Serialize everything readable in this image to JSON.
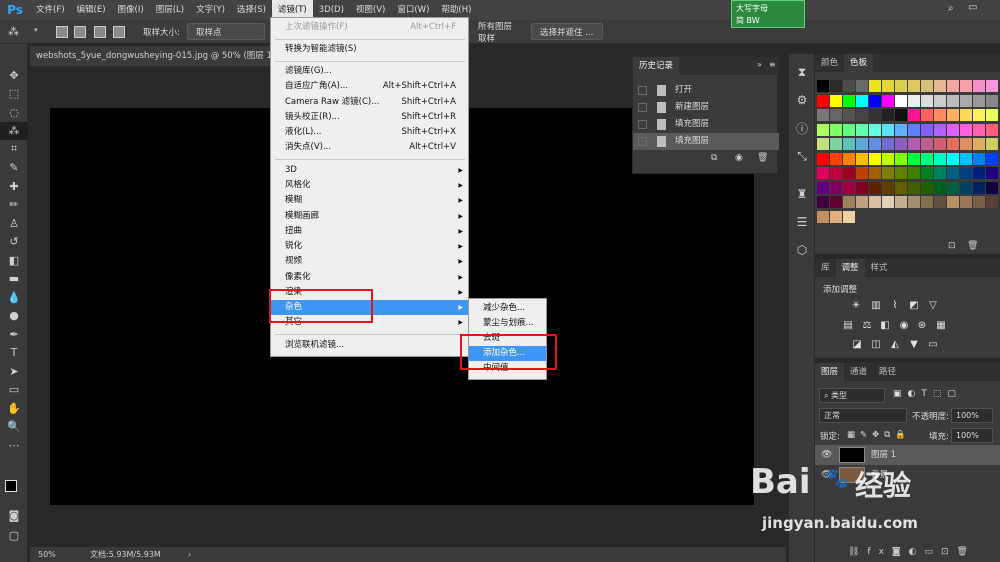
{
  "app": {
    "logo": "Ps"
  },
  "menubar": {
    "items": [
      "文件(F)",
      "编辑(E)",
      "图像(I)",
      "图层(L)",
      "文字(Y)",
      "选择(S)",
      "滤镜(T)",
      "3D(D)",
      "视图(V)",
      "窗口(W)",
      "帮助(H)"
    ],
    "active": "滤镜(T)"
  },
  "capslock": {
    "line1": "大写字母",
    "line2": "简 BW"
  },
  "options": {
    "sample_size_label": "取样大小:",
    "sample_size_value": "取样点",
    "layer_sample_label": "所有图层取样",
    "select_mask_button": "选择并遮住 ..."
  },
  "document": {
    "tab_title": "webshots_5yue_dongwusheying-015.jpg @ 50% (图层 1, R",
    "zoom": "50%",
    "doc_info": "文档:5.93M/5.93M"
  },
  "filter_menu": {
    "items": [
      {
        "label": "上次滤镜操作(F)",
        "shortcut": "Alt+Ctrl+F",
        "disabled": true
      },
      {
        "label": "转换为智能滤镜(S)"
      },
      {
        "label": "滤镜库(G)..."
      },
      {
        "label": "自适应广角(A)...",
        "shortcut": "Alt+Shift+Ctrl+A"
      },
      {
        "label": "Camera Raw 滤镜(C)...",
        "shortcut": "Shift+Ctrl+A"
      },
      {
        "label": "镜头校正(R)...",
        "shortcut": "Shift+Ctrl+R"
      },
      {
        "label": "液化(L)...",
        "shortcut": "Shift+Ctrl+X"
      },
      {
        "label": "消失点(V)...",
        "shortcut": "Alt+Ctrl+V"
      },
      {
        "label": "3D",
        "submenu": true
      },
      {
        "label": "风格化",
        "submenu": true
      },
      {
        "label": "模糊",
        "submenu": true
      },
      {
        "label": "模糊画廊",
        "submenu": true
      },
      {
        "label": "扭曲",
        "submenu": true
      },
      {
        "label": "锐化",
        "submenu": true
      },
      {
        "label": "视频",
        "submenu": true
      },
      {
        "label": "像素化",
        "submenu": true
      },
      {
        "label": "渲染",
        "submenu": true
      },
      {
        "label": "杂色",
        "submenu": true,
        "highlighted": true
      },
      {
        "label": "其它",
        "submenu": true
      },
      {
        "label": "浏览联机滤镜..."
      }
    ]
  },
  "noise_submenu": {
    "items": [
      "减少杂色...",
      "蒙尘与划痕...",
      "去斑",
      "添加杂色...",
      "中间值..."
    ],
    "highlighted": "添加杂色..."
  },
  "history": {
    "title": "历史记录",
    "items": [
      "打开",
      "新建图层",
      "填充图层",
      "填充图层"
    ]
  },
  "swatches": {
    "tabs": [
      "颜色",
      "色板"
    ],
    "active": "色板",
    "colors": [
      [
        "#000000",
        "#2a2a2a",
        "#4c4c4c",
        "#686868",
        "#e8e420",
        "#e0d838",
        "#d8d050",
        "#e0c860",
        "#d8c078",
        "#e4b890",
        "#f0a8a0",
        "#f8a0b0",
        "#f890c8",
        "#f898d8"
      ],
      [
        "#ff0000",
        "#ffff00",
        "#00ff00",
        "#00ffff",
        "#0000ff",
        "#ff00ff",
        "#ffffff",
        "#eeeeee",
        "#dddddd",
        "#cccccc",
        "#bbbbbb",
        "#aaaaaa",
        "#999999",
        "#888888"
      ],
      [
        "#777777",
        "#666666",
        "#555555",
        "#444444",
        "#333333",
        "#222222",
        "#111111",
        "#ff1493",
        "#ff6060",
        "#ff8c60",
        "#ffb060",
        "#ffd860",
        "#fff060",
        "#e8ff60"
      ],
      [
        "#b0ff60",
        "#80ff60",
        "#60ff80",
        "#60ffb0",
        "#60ffe0",
        "#60e0ff",
        "#60b0ff",
        "#6080ff",
        "#8060ff",
        "#b060ff",
        "#e060ff",
        "#ff60e0",
        "#ff60b0",
        "#ff6080"
      ],
      [
        "#c0e080",
        "#80d0a0",
        "#60c0c0",
        "#60a8d8",
        "#6090e0",
        "#7070d0",
        "#9060c0",
        "#b060b0",
        "#c06090",
        "#d06070",
        "#e07060",
        "#e09060",
        "#e0b060",
        "#d0d060"
      ],
      [
        "#ff0000",
        "#ff4000",
        "#ff8000",
        "#ffc000",
        "#ffff00",
        "#c0ff00",
        "#80ff00",
        "#00ff40",
        "#00ff80",
        "#00ffc0",
        "#00ffff",
        "#00c0ff",
        "#0080ff",
        "#0040ff"
      ],
      [
        "#e00060",
        "#c00040",
        "#a00020",
        "#c04000",
        "#a06000",
        "#808000",
        "#608000",
        "#408000",
        "#008020",
        "#008060",
        "#006080",
        "#004080",
        "#002080",
        "#200080"
      ],
      [
        "#600080",
        "#800060",
        "#a00040",
        "#800020",
        "#602000",
        "#604000",
        "#606000",
        "#406000",
        "#206000",
        "#006020",
        "#006040",
        "#004060",
        "#002060",
        "#100040"
      ],
      [
        "#400040",
        "#600030",
        "#a08060",
        "#c0a080",
        "#d8c0a0",
        "#e0d0b8",
        "#c0b090",
        "#a09070",
        "#807050",
        "#605040",
        "#b89068",
        "#987858",
        "#786048",
        "#584038"
      ],
      [
        "#c09060",
        "#e0b080",
        "#f0d0a0"
      ]
    ]
  },
  "adjustments": {
    "tabs": [
      "库",
      "调整",
      "样式"
    ],
    "active": "调整",
    "title": "添加调整"
  },
  "layers": {
    "tabs": [
      "图层",
      "通道",
      "路径"
    ],
    "active": "图层",
    "filter_kind": "类型",
    "blend_mode": "正常",
    "opacity_label": "不透明度:",
    "opacity_value": "100%",
    "lock_label": "锁定:",
    "fill_label": "填充:",
    "fill_value": "100%",
    "items": [
      {
        "name": "图层 1",
        "selected": true
      },
      {
        "name": "背景",
        "selected": false
      }
    ]
  },
  "watermark": {
    "brand": "Bai",
    "brand2": "经验",
    "url": "jingyan.baidu.com"
  }
}
